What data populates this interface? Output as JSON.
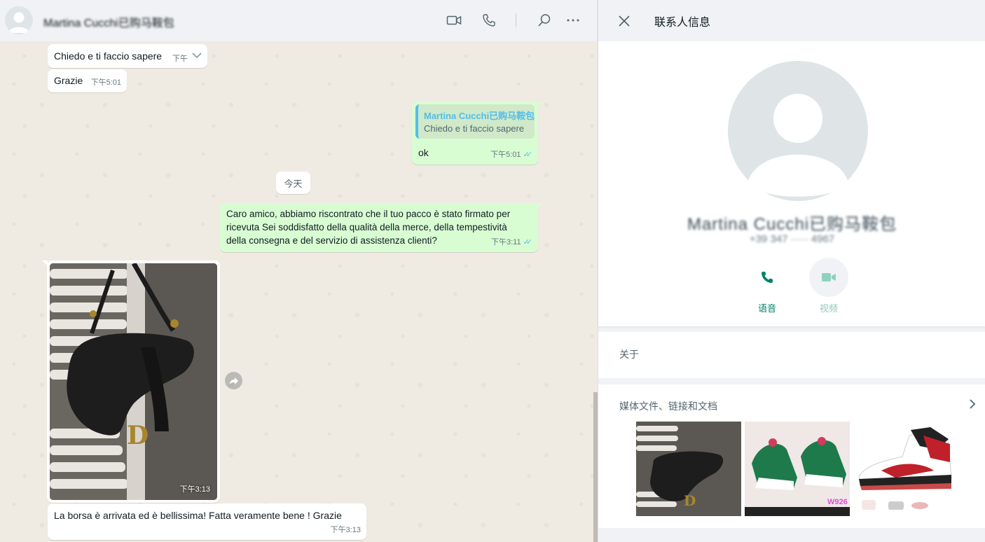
{
  "chat": {
    "contact_name": "Martina Cucchi已购马鞍包",
    "header_icons": [
      "video-call-icon",
      "voice-call-icon",
      "search-icon",
      "menu-icon"
    ],
    "messages": [
      {
        "direction": "in",
        "text": "Chiedo e ti faccio sapere",
        "time": "下午"
      },
      {
        "direction": "in",
        "text": "Grazie",
        "time": "下午5:01"
      },
      {
        "direction": "out",
        "quote_author": "Martina Cucchi已购马鞍包",
        "quote_text": "Chiedo e ti faccio sapere",
        "text": "ok",
        "time": "下午5:01",
        "status": "read"
      },
      {
        "direction": "out",
        "text_lines": [
          "Caro amico, abbiamo riscontrato che il tuo pacco è stato firmato per",
          "ricevuta Sei soddisfatto della qualità della merce, della tempestività",
          "della consegna e del servizio di assistenza clienti?"
        ],
        "time": "下午3:11",
        "status": "read"
      },
      {
        "direction": "in",
        "type": "image",
        "time": "下午3:13"
      },
      {
        "direction": "in",
        "text": "La borsa è arrivata ed è bellissima! Fatta veramente bene ! Grazie",
        "time": "下午3:13"
      }
    ],
    "day_divider": "今天"
  },
  "contact_info": {
    "title": "联系人信息",
    "name": "Martina Cucchi已购马鞍包",
    "phone": "+39 347 ····· 4967",
    "actions": {
      "voice_label": "语音",
      "video_label": "视频"
    },
    "about_label": "关于",
    "media_label": "媒体文件、链接和文档",
    "media_thumb_caption": "W926"
  },
  "colors": {
    "accent_green": "#008069",
    "outgoing_bubble": "#d9fdd3",
    "read_ticks": "#53bdeb",
    "chat_background": "#efeae2"
  }
}
